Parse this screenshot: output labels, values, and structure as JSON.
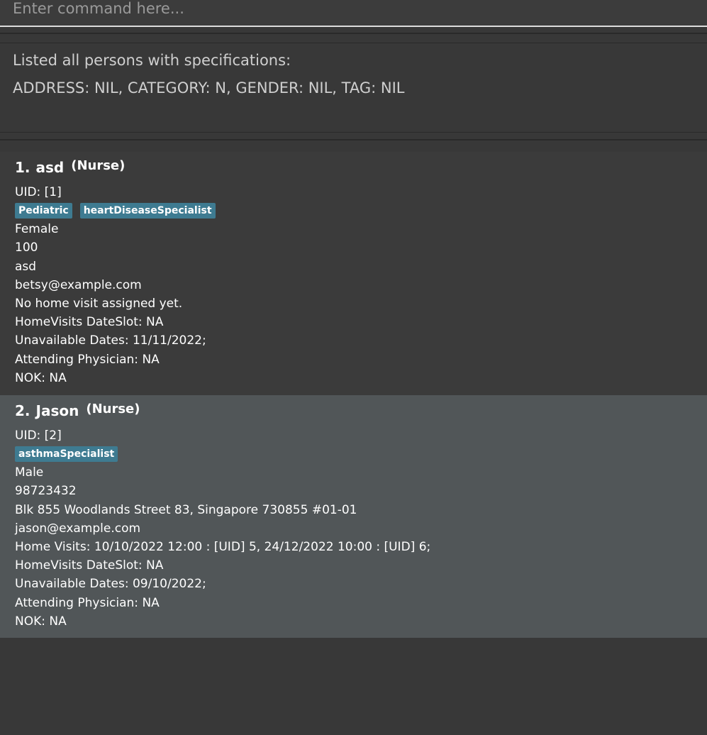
{
  "command": {
    "placeholder": "Enter command here..."
  },
  "result": {
    "line1": "Listed all persons with specifications:",
    "line2": "ADDRESS: NIL, CATEGORY: N, GENDER: NIL, TAG: NIL"
  },
  "persons": [
    {
      "index": "1.",
      "name": "asd",
      "category": "(Nurse)",
      "uid": "UID: [1]",
      "tags": [
        "Pediatric",
        "heartDiseaseSpecialist"
      ],
      "gender": "Female",
      "phone": "100",
      "address": "asd",
      "email": "betsy@example.com",
      "home_visits": "No home visit assigned yet.",
      "dateslot": "HomeVisits DateSlot: NA",
      "unavailable": "Unavailable Dates: 11/11/2022;",
      "physician": "Attending Physician: NA",
      "nok": "NOK: NA"
    },
    {
      "index": "2.",
      "name": "Jason",
      "category": "(Nurse)",
      "uid": "UID: [2]",
      "tags": [
        "asthmaSpecialist"
      ],
      "gender": "Male",
      "phone": "98723432",
      "address": "Blk 855 Woodlands Street 83, Singapore 730855 #01-01",
      "email": "jason@example.com",
      "home_visits": "Home Visits: 10/10/2022 12:00 : [UID] 5, 24/12/2022 10:00 : [UID] 6;",
      "dateslot": "HomeVisits DateSlot: NA",
      "unavailable": "Unavailable Dates: 09/10/2022;",
      "physician": "Attending Physician: NA",
      "nok": "NOK: NA"
    }
  ]
}
